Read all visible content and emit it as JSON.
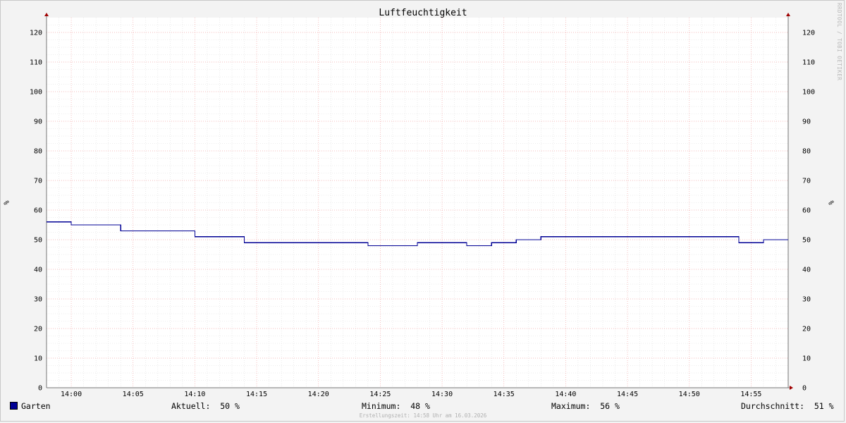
{
  "chart_data": {
    "type": "line",
    "title": "Luftfeuchtigkeit",
    "ylabel": "%",
    "y2label": "%",
    "ylim": [
      0,
      125
    ],
    "yticks": [
      0,
      10,
      20,
      30,
      40,
      50,
      60,
      70,
      80,
      90,
      100,
      110,
      120
    ],
    "xlim": [
      "13:58",
      "14:58"
    ],
    "xticks": [
      "14:00",
      "14:05",
      "14:10",
      "14:15",
      "14:20",
      "14:25",
      "14:30",
      "14:35",
      "14:40",
      "14:45",
      "14:50",
      "14:55"
    ],
    "grid": true,
    "legend_position": "bottom",
    "series": [
      {
        "name": "Garten",
        "color": "#000094",
        "step": true,
        "points": [
          {
            "x": "13:58",
            "y": 56
          },
          {
            "x": "14:00",
            "y": 55
          },
          {
            "x": "14:04",
            "y": 53
          },
          {
            "x": "14:10",
            "y": 51
          },
          {
            "x": "14:14",
            "y": 49
          },
          {
            "x": "14:24",
            "y": 48
          },
          {
            "x": "14:28",
            "y": 49
          },
          {
            "x": "14:32",
            "y": 48
          },
          {
            "x": "14:34",
            "y": 49
          },
          {
            "x": "14:36",
            "y": 50
          },
          {
            "x": "14:38",
            "y": 51
          },
          {
            "x": "14:54",
            "y": 49
          },
          {
            "x": "14:56",
            "y": 50
          },
          {
            "x": "14:58",
            "y": 50
          }
        ]
      }
    ]
  },
  "watermark": "RRDTOOL / TOBI OETIKER",
  "legend": {
    "series_name": "Garten",
    "swatch_color": "#000094",
    "current": "Aktuell:  50 %",
    "minimum": "Minimum:  48 %",
    "maximum": "Maximum:  56 %",
    "average": "Durchschnitt:  51 %"
  },
  "footer": "Erstellungszeit: 14:58 Uhr am 16.03.2026"
}
